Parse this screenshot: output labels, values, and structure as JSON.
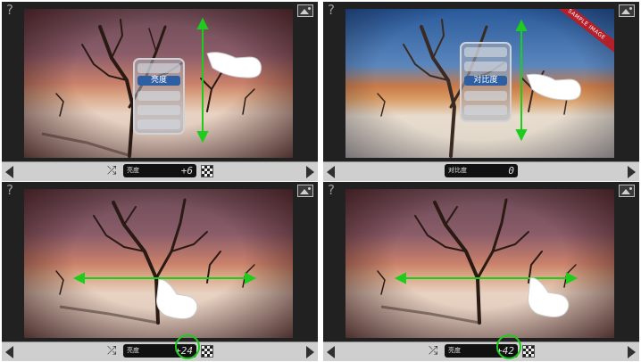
{
  "accent": "#1ecc1e",
  "panels": [
    {
      "help": "?",
      "param_label": "亮度",
      "param_value": "+6",
      "menu_selected": "亮度",
      "gesture": "vertical-swipe",
      "ribbon": ""
    },
    {
      "help": "?",
      "param_label": "对比度",
      "param_value": "0",
      "menu_selected": "对比度",
      "gesture": "vertical-swipe",
      "ribbon": "SAMPLE IMAGE"
    },
    {
      "help": "?",
      "param_label": "亮度",
      "param_value": "+24",
      "menu_selected": "",
      "gesture": "horizontal-swipe",
      "ribbon": ""
    },
    {
      "help": "?",
      "param_label": "亮度",
      "param_value": "+42",
      "menu_selected": "",
      "gesture": "horizontal-swipe",
      "ribbon": ""
    }
  ],
  "icons": {
    "help": "question-mark",
    "gallery": "image-icon",
    "shuffle": "shuffle-icon",
    "compare": "checkerboard-icon",
    "prev": "triangle-left",
    "next": "triangle-right"
  }
}
